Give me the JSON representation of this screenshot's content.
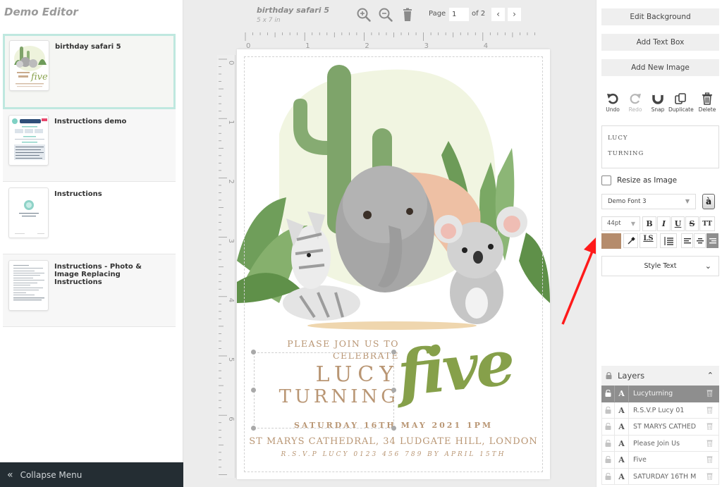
{
  "app": {
    "title": "Demo Editor"
  },
  "sidebar": {
    "documents": [
      {
        "title": "birthday safari 5",
        "selected": true,
        "thumb": "safari-invite-thumbnail"
      },
      {
        "title": "Instructions demo",
        "selected": false,
        "thumb": "instructions-demo-thumbnail"
      },
      {
        "title": "Instructions",
        "selected": false,
        "thumb": "instructions-thumbnail"
      },
      {
        "title": "Instructions - Photo & Image Replacing Instructions",
        "selected": false,
        "thumb": "photo-instructions-thumbnail"
      }
    ],
    "collapse_label": "Collapse Menu",
    "collapse_icon": "double-chevron-left-icon"
  },
  "toolbar": {
    "doc_name": "birthday safari 5",
    "doc_size": "5 x 7 in",
    "icons": [
      "zoom-in-icon",
      "zoom-out-icon",
      "trash-icon"
    ],
    "page_label": "Page",
    "page_value": "1",
    "page_of": "of 2",
    "prev_label": "‹",
    "next_label": "›"
  },
  "rulers": {
    "top_ticks": [
      "0",
      "1",
      "2",
      "3",
      "4"
    ],
    "left_ticks": [
      "0",
      "1",
      "2",
      "3",
      "4",
      "5",
      "6"
    ]
  },
  "invitation": {
    "please": "PLEASE JOIN US TO",
    "celebrate": "CELEBRATE",
    "lucy": "LUCY",
    "turning": "TURNING",
    "five": "five",
    "date": "SATURDAY 16TH MAY 2021 1PM",
    "venue": "ST MARYS CATHEDRAL, 34 LUDGATE HILL, LONDON",
    "rsvp": "R.S.V.P LUCY 0123 456 789 BY APRIL 15TH",
    "text_color": "#b99674",
    "five_color": "#86a04a"
  },
  "panel": {
    "edit_background": "Edit Background",
    "add_text_box": "Add Text Box",
    "add_new_image": "Add New Image",
    "actions": [
      {
        "label": "Undo",
        "icon": "undo-icon",
        "enabled": true
      },
      {
        "label": "Redo",
        "icon": "redo-icon",
        "enabled": false
      },
      {
        "label": "Snap",
        "icon": "magnet-icon",
        "enabled": true
      },
      {
        "label": "Duplicate",
        "icon": "duplicate-icon",
        "enabled": true
      },
      {
        "label": "Delete",
        "icon": "trash-icon",
        "enabled": true
      }
    ],
    "text_preview": {
      "line1": "LUCY",
      "line2": "TURNING"
    },
    "resize_as_image": {
      "label": "Resize as Image",
      "checked": false
    },
    "font": "Demo Font 3",
    "glyph_button": "à",
    "font_size": "44pt",
    "format_buttons": {
      "bold": "B",
      "italic": "I",
      "underline": "U",
      "strike": "S",
      "caps": "TT",
      "letter_spacing": "LS"
    },
    "text_color": "#b58c6c",
    "align_active": "right",
    "style_text": "Style Text"
  },
  "layers": {
    "title": "Layers",
    "items": [
      {
        "name": "Lucyturning",
        "type": "A",
        "active": true
      },
      {
        "name": "R.S.V.P Lucy 01",
        "type": "A",
        "active": false
      },
      {
        "name": "ST MARYS CATHED",
        "type": "A",
        "active": false
      },
      {
        "name": "Please Join Us",
        "type": "A",
        "active": false
      },
      {
        "name": "Five",
        "type": "A",
        "active": false
      },
      {
        "name": "SATURDAY 16TH M",
        "type": "A",
        "active": false
      }
    ]
  },
  "annotation": {
    "type": "red-arrow",
    "color": "#ff1a1a",
    "points_to": "text-color-swatch"
  }
}
